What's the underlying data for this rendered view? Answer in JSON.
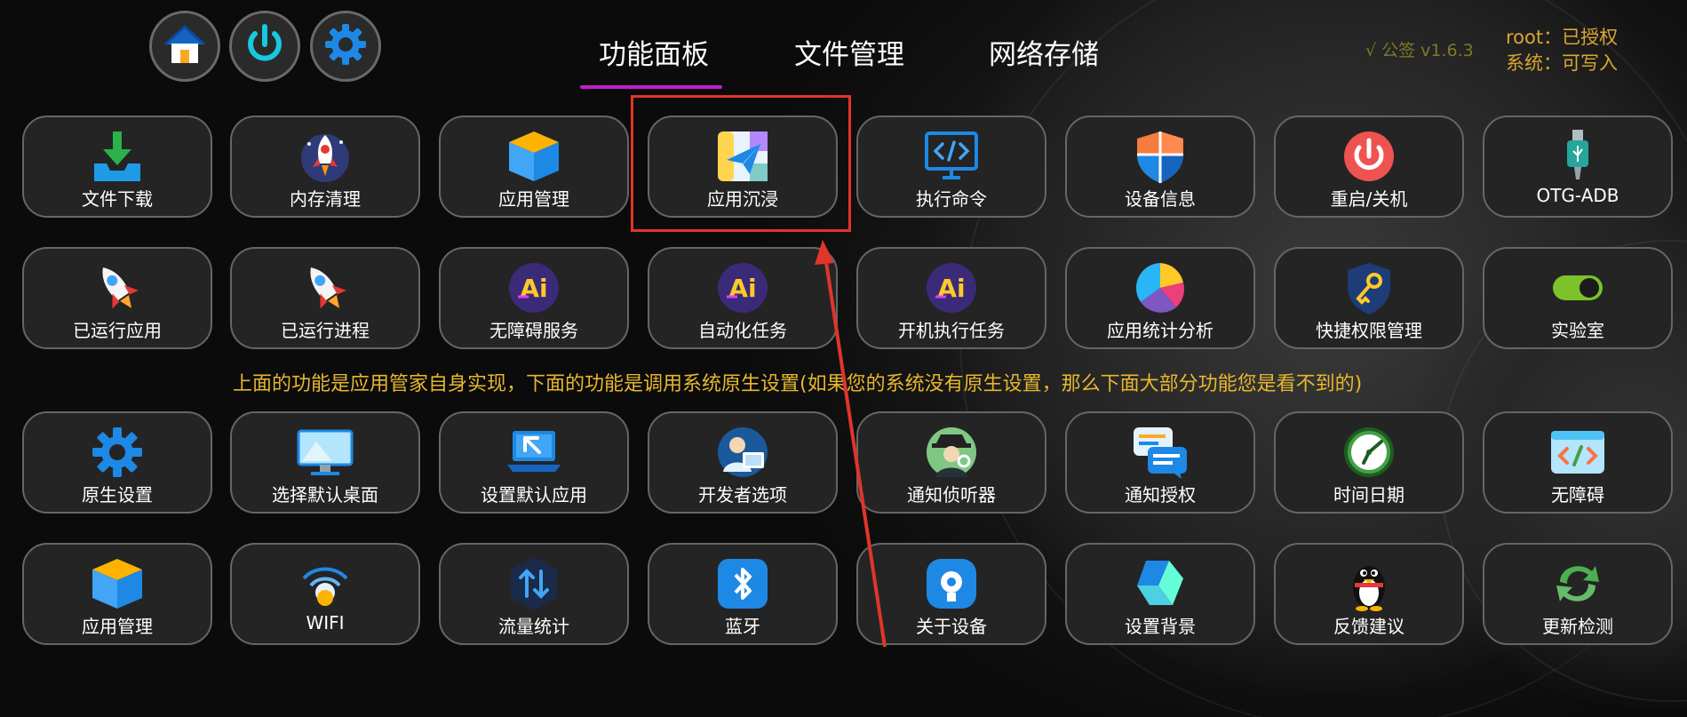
{
  "tabs": [
    {
      "label": "功能面板",
      "active": true
    },
    {
      "label": "文件管理",
      "active": false
    },
    {
      "label": "网络存储",
      "active": false
    }
  ],
  "top_buttons": [
    {
      "icon": "home-icon"
    },
    {
      "icon": "power-icon"
    },
    {
      "icon": "gear-icon"
    }
  ],
  "version": "√ 公签 v1.6.3",
  "status": {
    "root": "root：已授权",
    "system": "系统：可写入"
  },
  "notice": "上面的功能是应用管家自身实现，下面的功能是调用系统原生设置(如果您的系统没有原生设置，那么下面大部分功能您是看不到的)",
  "rows": [
    [
      {
        "label": "文件下载",
        "icon": "download-icon"
      },
      {
        "label": "内存清理",
        "icon": "rocket-badge-icon"
      },
      {
        "label": "应用管理",
        "icon": "box-icon"
      },
      {
        "label": "应用沉浸",
        "icon": "paper-plane-map-icon"
      },
      {
        "label": "执行命令",
        "icon": "code-monitor-icon"
      },
      {
        "label": "设备信息",
        "icon": "shield-icon"
      },
      {
        "label": "重启/关机",
        "icon": "power-icon"
      },
      {
        "label": "OTG-ADB",
        "icon": "usb-icon"
      }
    ],
    [
      {
        "label": "已运行应用",
        "icon": "rocket-icon"
      },
      {
        "label": "已运行进程",
        "icon": "rocket-icon"
      },
      {
        "label": "无障碍服务",
        "icon": "ai-icon"
      },
      {
        "label": "自动化任务",
        "icon": "ai-icon"
      },
      {
        "label": "开机执行任务",
        "icon": "ai-icon"
      },
      {
        "label": "应用统计分析",
        "icon": "pie-chart-icon"
      },
      {
        "label": "快捷权限管理",
        "icon": "key-shield-icon"
      },
      {
        "label": "实验室",
        "icon": "toggle-icon"
      }
    ],
    [
      {
        "label": "原生设置",
        "icon": "gear-icon"
      },
      {
        "label": "选择默认桌面",
        "icon": "monitor-icon"
      },
      {
        "label": "设置默认应用",
        "icon": "laptop-arrow-icon"
      },
      {
        "label": "开发者选项",
        "icon": "developer-icon"
      },
      {
        "label": "通知侦听器",
        "icon": "detective-icon"
      },
      {
        "label": "通知授权",
        "icon": "chat-icon"
      },
      {
        "label": "时间日期",
        "icon": "clock-icon"
      },
      {
        "label": "无障碍",
        "icon": "code-window-icon"
      }
    ],
    [
      {
        "label": "应用管理",
        "icon": "box-icon"
      },
      {
        "label": "WIFI",
        "icon": "wifi-icon"
      },
      {
        "label": "流量统计",
        "icon": "traffic-icon"
      },
      {
        "label": "蓝牙",
        "icon": "bluetooth-icon"
      },
      {
        "label": "关于设备",
        "icon": "about-device-icon"
      },
      {
        "label": "设置背景",
        "icon": "wallpaper-icon"
      },
      {
        "label": "反馈建议",
        "icon": "penguin-icon"
      },
      {
        "label": "更新检测",
        "icon": "refresh-icon"
      }
    ]
  ],
  "colors": {
    "tab_underline": "#c21ecf",
    "notice": "#e7b72d",
    "status": "#d9a630",
    "highlight": "#e0352b"
  }
}
